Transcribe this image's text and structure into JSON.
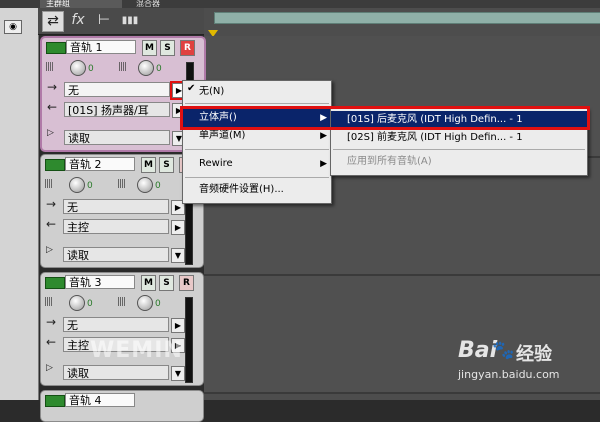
{
  "tabs": [
    "主群组",
    "混合器"
  ],
  "toolbar": {
    "buttons": [
      "⇄",
      "fx",
      "⊢",
      "▮▮▮"
    ]
  },
  "tracks": [
    {
      "name": "音轨 1",
      "m": "M",
      "s": "S",
      "r": "R",
      "vol": "0",
      "pan": "0",
      "input": "无",
      "output": "[01S] 扬声器/耳",
      "automation": "读取"
    },
    {
      "name": "音轨 2",
      "m": "M",
      "s": "S",
      "r": "R",
      "vol": "0",
      "pan": "0",
      "input": "无",
      "output": "主控",
      "automation": "读取"
    },
    {
      "name": "音轨 3",
      "m": "M",
      "s": "S",
      "r": "R",
      "vol": "0",
      "pan": "0",
      "input": "无",
      "output": "主控",
      "automation": "读取"
    },
    {
      "name": "音轨 4"
    }
  ],
  "menu1": {
    "items": [
      {
        "label": "无(N)",
        "checked": "✔"
      },
      {
        "label": "立体声()",
        "submenu": "▶"
      },
      {
        "label": "单声道(M)",
        "submenu": "▶"
      },
      {
        "label": "Rewire",
        "submenu": "▶"
      },
      {
        "label": "音频硬件设置(H)..."
      }
    ]
  },
  "menu2": {
    "items": [
      {
        "label": "[01S] 后麦克风 (IDT High Defin... - 1"
      },
      {
        "label": "[02S] 前麦克风 (IDT High Defin... - 1"
      },
      {
        "label": "应用到所有音轨(A)"
      }
    ]
  },
  "watermarks": {
    "left": "WEMIN",
    "right_brand": "Bai",
    "right_paw": "🐾",
    "right_text": "经验",
    "url": "jingyan.baidu.com"
  },
  "colors": {
    "accent": "#e01010",
    "selection": "#0a246a",
    "active_track": "#d8bfd3"
  }
}
